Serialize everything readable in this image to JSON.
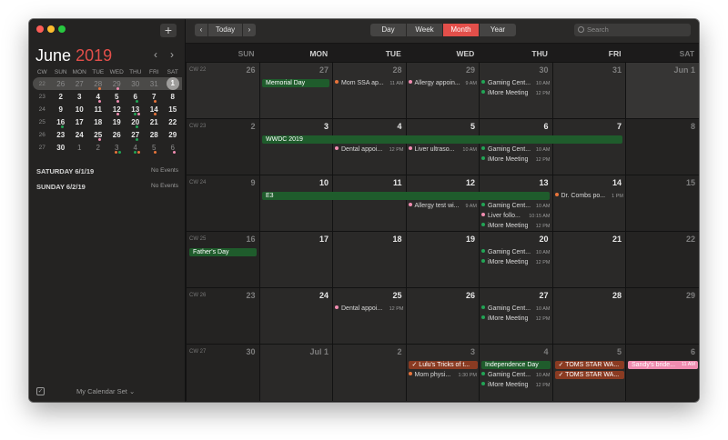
{
  "colors": {
    "accent": "#e34f4a",
    "green": "#22a455",
    "pink": "#f08cb0",
    "orange": "#e8743b",
    "event_green": "#1f5c2c"
  },
  "sidebar": {
    "add_label": "+",
    "month": "June",
    "year": "2019",
    "prev_icon": "‹",
    "next_icon": "›",
    "weekday_headers": [
      "CW",
      "SUN",
      "MON",
      "TUE",
      "WED",
      "THU",
      "FRI",
      "SAT"
    ],
    "weeks": [
      [
        "22",
        "26",
        "27",
        "28",
        "29",
        "30",
        "31",
        "1"
      ],
      [
        "23",
        "2",
        "3",
        "4",
        "5",
        "6",
        "7",
        "8"
      ],
      [
        "24",
        "9",
        "10",
        "11",
        "12",
        "13",
        "14",
        "15"
      ],
      [
        "25",
        "16",
        "17",
        "18",
        "19",
        "20",
        "21",
        "22"
      ],
      [
        "26",
        "23",
        "24",
        "25",
        "26",
        "27",
        "28",
        "29"
      ],
      [
        "27",
        "30",
        "1",
        "2",
        "3",
        "4",
        "5",
        "6"
      ]
    ],
    "agenda": [
      {
        "day": "SATURDAY 6/1/19",
        "status": "No Events"
      },
      {
        "day": "SUNDAY 6/2/19",
        "status": "No Events"
      }
    ],
    "calendar_set": "My Calendar Set ⌄"
  },
  "toolbar": {
    "prev_icon": "‹",
    "today_label": "Today",
    "next_icon": "›",
    "views": [
      "Day",
      "Week",
      "Month",
      "Year"
    ],
    "active_view": "Month",
    "search_placeholder": "Search"
  },
  "calendar": {
    "day_headers": [
      "SUN",
      "MON",
      "TUE",
      "WED",
      "THU",
      "FRI",
      "SAT"
    ],
    "weeks": [
      {
        "cw": "CW 22",
        "days": [
          "26",
          "27",
          "28",
          "29",
          "30",
          "31",
          "Jun 1"
        ]
      },
      {
        "cw": "CW 23",
        "days": [
          "2",
          "3",
          "4",
          "5",
          "6",
          "7",
          "8"
        ]
      },
      {
        "cw": "CW 24",
        "days": [
          "9",
          "10",
          "11",
          "12",
          "13",
          "14",
          "15"
        ]
      },
      {
        "cw": "CW 25",
        "days": [
          "16",
          "17",
          "18",
          "19",
          "20",
          "21",
          "22"
        ]
      },
      {
        "cw": "CW 26",
        "days": [
          "23",
          "24",
          "25",
          "26",
          "27",
          "28",
          "29"
        ]
      },
      {
        "cw": "CW 27",
        "days": [
          "30",
          "Jul 1",
          "2",
          "3",
          "4",
          "5",
          "6"
        ]
      }
    ],
    "banners": {
      "memorial_day": "Memorial Day",
      "wwdc": "WWDC 2019",
      "e3": "E3",
      "fathers_day": "Father's Day",
      "lulu": "✓ Lulu's Tricks of t...",
      "independence_day": "Independence Day",
      "toms_1": "✓ TOMS STAR WA...",
      "toms_2": "✓ TOMS STAR WA...",
      "sandy": "Sandy's bride...",
      "sandy_time": "11 AM"
    },
    "events": {
      "w0_tue": {
        "title": "Mom SSA ap...",
        "time": "11 AM"
      },
      "w0_wed": {
        "title": "Allergy appoin...",
        "time": "9 AM"
      },
      "w0_thu_1": {
        "title": "Gaming Cent...",
        "time": "10 AM"
      },
      "w0_thu_2": {
        "title": "iMore Meeting",
        "time": "12 PM"
      },
      "w1_tue": {
        "title": "Dental appoi...",
        "time": "12 PM"
      },
      "w1_wed": {
        "title": "Liver ultraso...",
        "time": "10 AM"
      },
      "w1_thu_1": {
        "title": "Gaming Cent...",
        "time": "10 AM"
      },
      "w1_thu_2": {
        "title": "iMore Meeting",
        "time": "12 PM"
      },
      "w2_wed": {
        "title": "Allergy test wi...",
        "time": "9 AM"
      },
      "w2_thu_1": {
        "title": "Gaming Cent...",
        "time": "10 AM"
      },
      "w2_thu_2": {
        "title": "Liver follo...",
        "time": "10:15 AM"
      },
      "w2_thu_3": {
        "title": "iMore Meeting",
        "time": "12 PM"
      },
      "w2_fri": {
        "title": "Dr. Combs po...",
        "time": "1 PM"
      },
      "w3_thu_1": {
        "title": "Gaming Cent...",
        "time": "10 AM"
      },
      "w3_thu_2": {
        "title": "iMore Meeting",
        "time": "12 PM"
      },
      "w4_tue": {
        "title": "Dental appoi...",
        "time": "12 PM"
      },
      "w4_thu_1": {
        "title": "Gaming Cent...",
        "time": "10 AM"
      },
      "w4_thu_2": {
        "title": "iMore Meeting",
        "time": "12 PM"
      },
      "w5_wed": {
        "title": "Mom physi...",
        "time": "1:30 PM"
      },
      "w5_thu_1": {
        "title": "Gaming Cent...",
        "time": "10 AM"
      },
      "w5_thu_2": {
        "title": "iMore Meeting",
        "time": "12 PM"
      }
    }
  }
}
